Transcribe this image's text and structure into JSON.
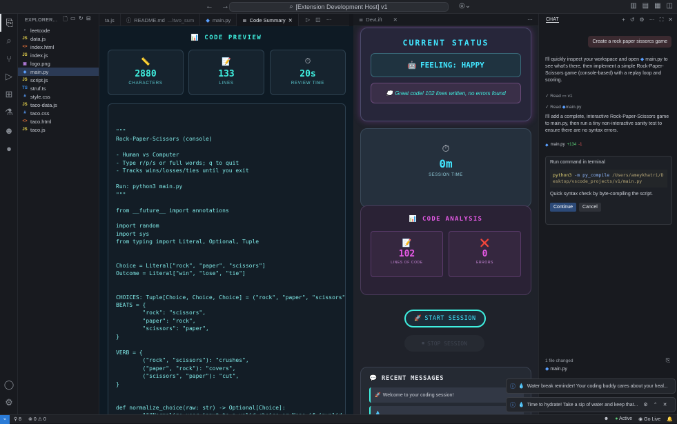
{
  "window": {
    "title": "[Extension Development Host] v1"
  },
  "explorer": {
    "header": "EXPLORER...",
    "files": [
      {
        "name": "leetcode",
        "type": "folder"
      },
      {
        "name": "data.js",
        "type": "js"
      },
      {
        "name": "index.html",
        "type": "html"
      },
      {
        "name": "index.js",
        "type": "js"
      },
      {
        "name": "logo.png",
        "type": "img"
      },
      {
        "name": "main.py",
        "type": "py",
        "selected": true
      },
      {
        "name": "script.js",
        "type": "js"
      },
      {
        "name": "struf.ts",
        "type": "ts"
      },
      {
        "name": "style.css",
        "type": "css"
      },
      {
        "name": "taco-data.js",
        "type": "js"
      },
      {
        "name": "taco.css",
        "type": "css"
      },
      {
        "name": "taco.html",
        "type": "html"
      },
      {
        "name": "taco.js",
        "type": "js"
      }
    ]
  },
  "tabs": [
    {
      "label": "ta.js",
      "active": false
    },
    {
      "label": "README.md",
      "detail": "...\\two_sum",
      "active": false
    },
    {
      "label": "main.py",
      "active": false
    },
    {
      "label": "Code Summary",
      "active": true
    }
  ],
  "preview": {
    "title": "CODE PREVIEW",
    "stats": [
      {
        "icon": "📏",
        "value": "2880",
        "label": "CHARACTERS"
      },
      {
        "icon": "📝",
        "value": "133",
        "label": "LINES"
      },
      {
        "icon": "⏱",
        "value": "20s",
        "label": "REVIEW TIME"
      }
    ],
    "code": "\"\"\"\nRock-Paper-Scissors (console)\n\n- Human vs Computer\n- Type r/p/s or full words; q to quit\n- Tracks wins/losses/ties until you exit\n\nRun: python3 main.py\n\"\"\"\n\nfrom __future__ import annotations\n\nimport random\nimport sys\nfrom typing import Literal, Optional, Tuple\n\n\nChoice = Literal[\"rock\", \"paper\", \"scissors\"]\nOutcome = Literal[\"win\", \"lose\", \"tie\"]\n\n\nCHOICES: Tuple[Choice, Choice, Choice] = (\"rock\", \"paper\", \"scissors\")\nBEATS = {\n        \"rock\": \"scissors\",\n        \"paper\": \"rock\",\n        \"scissors\": \"paper\",\n}\n\nVERB = {\n        (\"rock\", \"scissors\"): \"crushes\",\n        (\"paper\", \"rock\"): \"covers\",\n        (\"scissors\", \"paper\"): \"cut\",\n}\n\n\ndef normalize_choice(raw: str) -> Optional[Choice]:\n        \"\"\"Normalize user input to a valid choice or None if invalid"
  },
  "devlift": {
    "tab_label": "DevLift",
    "status_title": "CURRENT STATUS",
    "feeling_icon": "🤖",
    "feeling": "FEELING: HAPPY",
    "message_icon": "💭",
    "message": "Great code! 102 lines written, no errors found",
    "session_icon": "⏱",
    "session_time": "0m",
    "session_label": "SESSION TIME",
    "analysis_icon": "📊",
    "analysis_title": "CODE ANALYSIS",
    "lines_icon": "📝",
    "lines_value": "102",
    "lines_label": "LINES OF CODE",
    "errors_icon": "❌",
    "errors_value": "0",
    "errors_label": "ERRORS",
    "start_icon": "🚀",
    "start_label": "START SESSION",
    "stop_icon": "⏹",
    "stop_label": "STOP SESSION",
    "recent_icon": "💬",
    "recent_title": "RECENT MESSAGES",
    "recent": [
      {
        "icon": "🚀",
        "text": "Welcome to your coding session!"
      },
      {
        "icon": "💧",
        "text": ""
      }
    ]
  },
  "chat": {
    "title": "CHAT",
    "user_message": "Create a rock paper sissorcs game",
    "p1_a": "I'll quickly inspect your workspace and open",
    "p1_file": "main.py",
    "p1_b": "to see what's there, then implement a simple Rock-Paper-Scissors game (console-based) with a replay loop and scoring.",
    "read1": "Read",
    "read1_target": "v1",
    "read2": "Read",
    "read2_target": "main.py",
    "p2": "I'll add a complete, interactive Rock-Paper-Scissors game to main.py, then run a tiny non-interactive sanity test to ensure there are no syntax errors.",
    "chip_file": "main.py",
    "chip_add": "+134",
    "chip_del": "-1",
    "terminal_title": "Run command in terminal",
    "cmd_prog": "python3",
    "cmd_flag": "-m",
    "cmd_mod": "py_compile",
    "cmd_path": "/Users/ameykhatri/Desktop/vscode_projects/v1/main.py",
    "terminal_desc": "Quick syntax check by byte-compiling the script.",
    "continue": "Continue",
    "cancel": "Cancel",
    "changed": "1 file changed",
    "changed_file": "main.py"
  },
  "notifications": [
    {
      "icon": "💧",
      "text": "Water break reminder! Your coding buddy cares about your heal..."
    },
    {
      "icon": "💧",
      "text": "Time to hydrate! Take a sip of water and keep that..."
    }
  ],
  "status": {
    "ports": "8",
    "problems_errors": "0",
    "problems_warnings": "0",
    "active": "Active",
    "golive": "Go Live"
  }
}
